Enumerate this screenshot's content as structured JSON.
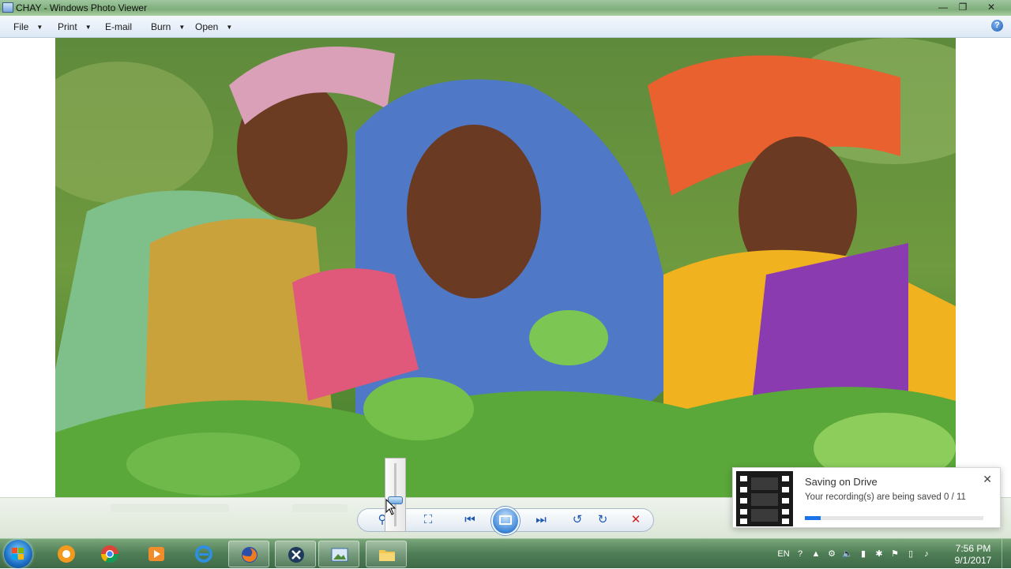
{
  "window": {
    "title": "CHAY - Windows Photo Viewer",
    "minimize_glyph": "—",
    "maximize_glyph": "❐",
    "close_glyph": "✕"
  },
  "menu": {
    "items": [
      {
        "label": "File"
      },
      {
        "label": "Print"
      },
      {
        "label": "E-mail"
      },
      {
        "label": "Burn"
      },
      {
        "label": "Open"
      }
    ],
    "help_glyph": "?"
  },
  "photo": {
    "description_icon": "image-photo"
  },
  "toolbar": {
    "prev_glyph": "⏮",
    "next_glyph": "⏭",
    "rotate_ccw_glyph": "↺",
    "rotate_cw_glyph": "↻",
    "delete_glyph": "✕",
    "fit_glyph": "⛶",
    "zoom_glyph": "⚲"
  },
  "notification": {
    "title": "Saving on Drive",
    "message": "Your recording(s) are being saved 0 / 11",
    "close_glyph": "✕",
    "progress_fraction": 0.09
  },
  "taskbar": {
    "language": "EN",
    "time": "7:56 PM",
    "date": "9/1/2017"
  },
  "colors": {
    "accent": "#1a73e8",
    "delete": "#cc1f1f"
  }
}
